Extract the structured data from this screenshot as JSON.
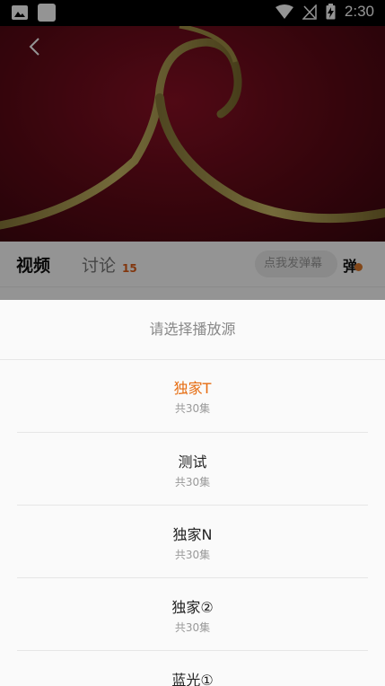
{
  "status_bar": {
    "time": "2:30",
    "icons": [
      "image-icon",
      "square-icon",
      "wifi-icon",
      "signal-icon",
      "battery-charging-icon"
    ]
  },
  "video": {
    "back_icon": "chevron-left-icon"
  },
  "tabs": {
    "video_label": "视频",
    "discuss_label": "讨论",
    "discuss_count": "15",
    "danmu_placeholder": "点我发弹幕",
    "danmu_button": "弹"
  },
  "sheet": {
    "title": "请选择播放源",
    "selected_color": "#e66d12",
    "sources": [
      {
        "name": "独家T",
        "episodes": "共30集",
        "selected": true
      },
      {
        "name": "测试",
        "episodes": "共30集",
        "selected": false
      },
      {
        "name": "独家N",
        "episodes": "共30集",
        "selected": false
      },
      {
        "name": "独家②",
        "episodes": "共30集",
        "selected": false
      },
      {
        "name": "蓝光①",
        "episodes": "",
        "selected": false
      }
    ]
  }
}
